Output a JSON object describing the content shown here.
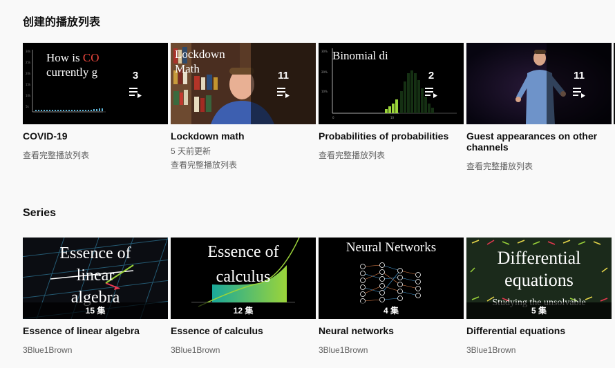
{
  "playlists_section": {
    "title": "创建的播放列表",
    "items": [
      {
        "title": "COVID-19",
        "count": "3",
        "meta": "",
        "link": "查看完整播放列表",
        "thumb_text": [
          "How is CO",
          "currently g"
        ]
      },
      {
        "title": "Lockdown math",
        "count": "11",
        "meta": "5 天前更新",
        "link": "查看完整播放列表",
        "thumb_text": [
          "Lockdown",
          "Math"
        ]
      },
      {
        "title": "Probabilities of probabilities",
        "count": "2",
        "meta": "",
        "link": "查看完整播放列表",
        "thumb_text": [
          "Binomial di"
        ]
      },
      {
        "title": "Guest appearances on other channels",
        "count": "11",
        "meta": "",
        "link": "查看完整播放列表",
        "thumb_text": []
      }
    ]
  },
  "series_section": {
    "title": "Series",
    "items": [
      {
        "title": "Essence of linear algebra",
        "episodes": "15 集",
        "channel": "3Blue1Brown",
        "thumb_text": [
          "Essence of",
          "linear",
          "algebra"
        ]
      },
      {
        "title": "Essence of calculus",
        "episodes": "12 集",
        "channel": "3Blue1Brown",
        "thumb_text": [
          "Essence of",
          "calculus"
        ]
      },
      {
        "title": "Neural networks",
        "episodes": "4 集",
        "channel": "3Blue1Brown",
        "thumb_text": [
          "Neural Networks"
        ]
      },
      {
        "title": "Differential equations",
        "episodes": "5 集",
        "channel": "3Blue1Brown",
        "thumb_text": [
          "Differential",
          "equations",
          "Studying the unsolvable"
        ]
      }
    ]
  },
  "colors": {
    "background": "#f9f9f9",
    "text_primary": "#0f0f0f",
    "text_secondary": "#606060",
    "covid_red": "#e8453c",
    "chart_green": "#9bd43a"
  },
  "icons": {
    "playlist": "playlist-icon"
  }
}
